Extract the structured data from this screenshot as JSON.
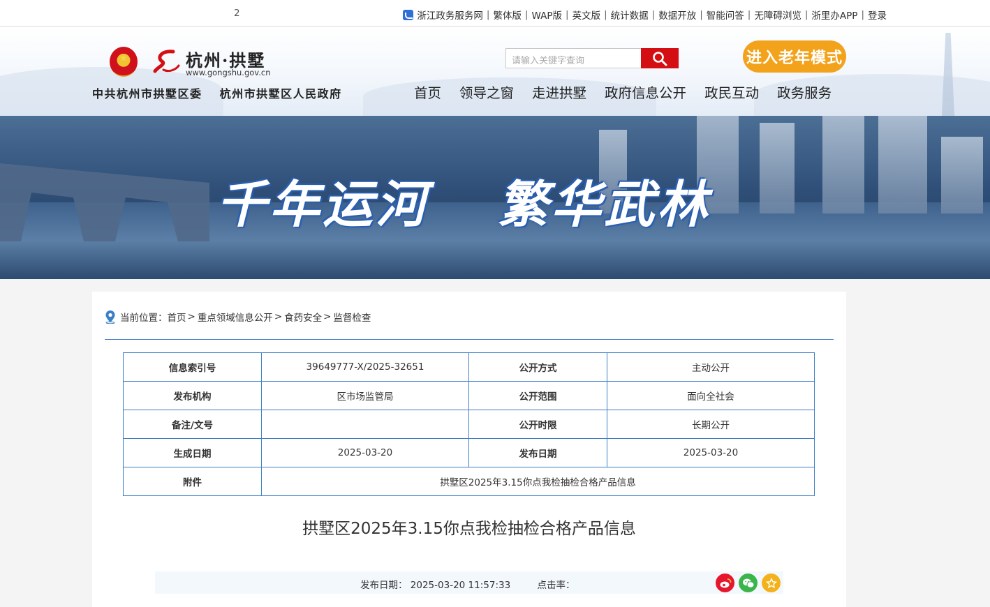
{
  "topbar": {
    "page_number": "2",
    "links": [
      "浙江政务服务网",
      "繁体版",
      "WAP版",
      "英文版",
      "统计数据",
      "数据开放",
      "智能问答",
      "无障碍浏览",
      "浙里办APP",
      "登录"
    ]
  },
  "header": {
    "logo_text": "杭州·拱墅",
    "logo_url": "www.gongshu.gov.cn",
    "org_party": "中共杭州市拱墅区委",
    "org_gov": "杭州市拱墅区人民政府",
    "search_placeholder": "请输入关键字查询",
    "elder_mode": "进入老年模式",
    "nav": [
      "首页",
      "领导之窗",
      "走进拱墅",
      "政府信息公开",
      "政民互动",
      "政务服务"
    ]
  },
  "banner": {
    "slogan_left": "千年运河",
    "slogan_right": "繁华武林"
  },
  "breadcrumb": {
    "prefix": "当前位置：",
    "items": [
      "首页",
      "重点领域信息公开",
      "食药安全",
      "监督检查"
    ]
  },
  "info_table": {
    "index_label": "信息索引号",
    "index_value": "39649777-X/2025-32651",
    "method_label": "公开方式",
    "method_value": "主动公开",
    "agency_label": "发布机构",
    "agency_value": "区市场监管局",
    "scope_label": "公开范围",
    "scope_value": "面向全社会",
    "remark_label": "备注/文号",
    "remark_value": "",
    "term_label": "公开时限",
    "term_value": "长期公开",
    "created_label": "生成日期",
    "created_value": "2025-03-20",
    "published_label": "发布日期",
    "published_value": "2025-03-20",
    "attachment_label": "附件",
    "attachment_value": "拱墅区2025年3.15你点我检抽检合格产品信息"
  },
  "article": {
    "title": "拱墅区2025年3.15你点我检抽检合格产品信息",
    "publish_date": "发布日期： 2025-03-20 11:57:33",
    "hits_label": "点击率："
  },
  "colors": {
    "accent_blue": "#3d7fc4",
    "search_red": "#d40f14",
    "elder_orange": "#f3a21b",
    "weibo_red": "#e6162d",
    "wechat_green": "#3bb44a",
    "favorite_yellow": "#f3b21b"
  }
}
